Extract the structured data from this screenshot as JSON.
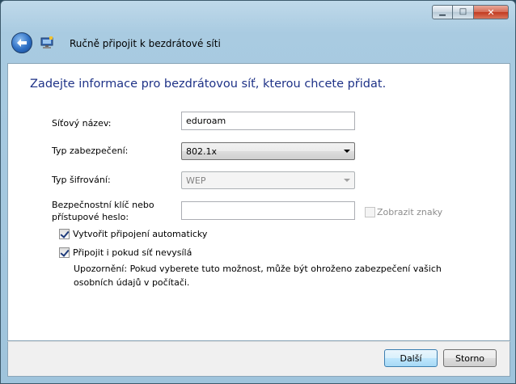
{
  "window": {
    "title": "Ručně připojit k bezdrátové síti",
    "controls": {
      "minimize_icon": "minimize-icon",
      "maximize_icon": "maximize-icon",
      "close_icon": "close-icon"
    }
  },
  "heading": "Zadejte informace pro bezdrátovou síť, kterou chcete přidat.",
  "form": {
    "network_name": {
      "label": "Síťový název:",
      "value": "eduroam"
    },
    "security_type": {
      "label": "Typ zabezpečení:",
      "value": "802.1x"
    },
    "encryption_type": {
      "label": "Typ šifrování:",
      "value": "WEP"
    },
    "security_key": {
      "label_line1": "Bezpečnostní klíč nebo",
      "label_line2": "přístupové heslo:",
      "value": ""
    },
    "show_chars": {
      "label": "Zobrazit znaky",
      "checked": false,
      "enabled": false
    },
    "auto_connect": {
      "label": "Vytvořit připojení automaticky",
      "checked": true
    },
    "connect_hidden": {
      "label": "Připojit i pokud síť nevysílá",
      "checked": true
    },
    "warning": "Upozornění: Pokud vyberete tuto možnost, může být ohroženo zabezpečení vašich osobních údajů v počítači."
  },
  "buttons": {
    "next": "Další",
    "cancel": "Storno"
  },
  "colors": {
    "heading": "#1e3287",
    "chrome": "#a9cbe1"
  }
}
